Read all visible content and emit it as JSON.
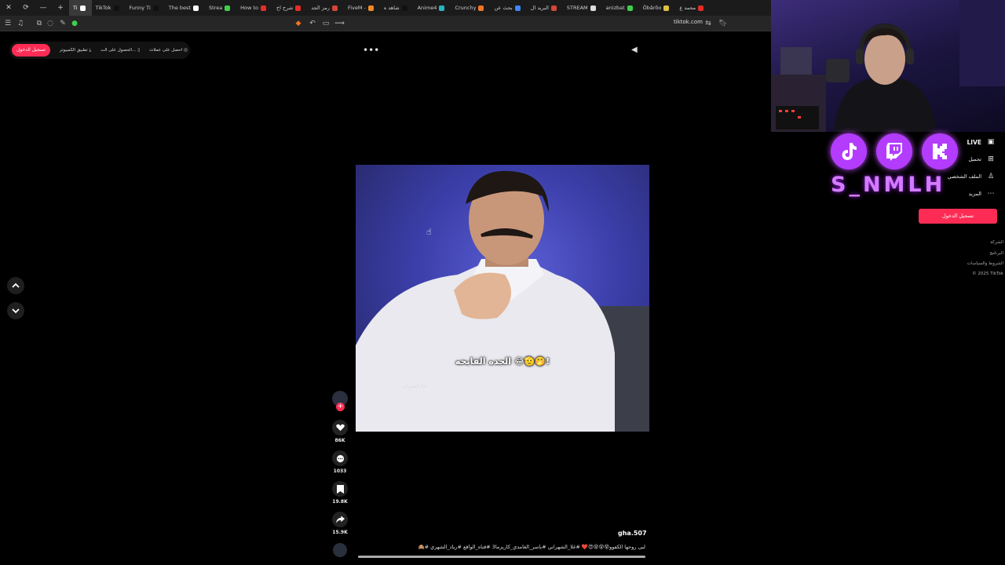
{
  "browser": {
    "tabs": [
      {
        "label": "Ti",
        "color": "#ffffff",
        "active": true
      },
      {
        "label": "TikTok",
        "color": "#111111"
      },
      {
        "label": "Funny Ti",
        "color": "#111111"
      },
      {
        "label": "The best",
        "color": "#ffffff"
      },
      {
        "label": "Strea",
        "color": "#3ecf4f"
      },
      {
        "label": "How to",
        "color": "#e52d27"
      },
      {
        "label": "شرح اخ",
        "color": "#e52d27"
      },
      {
        "label": "رمز الجد",
        "color": "#d44638"
      },
      {
        "label": "FiveM -",
        "color": "#f08a24"
      },
      {
        "label": "شاهد ه",
        "color": "#111111"
      },
      {
        "label": "Anime4",
        "color": "#2bb3c0"
      },
      {
        "label": "Crunchy",
        "color": "#f47521"
      },
      {
        "label": "بحث عن",
        "color": "#4285f4"
      },
      {
        "label": "البريد ال",
        "color": "#d44638"
      },
      {
        "label": "STREAM",
        "color": "#dddddd"
      },
      {
        "label": "anizbat",
        "color": "#3ecf4f"
      },
      {
        "label": "Öbârõo",
        "color": "#e0c040"
      },
      {
        "label": "محمد ع",
        "color": "#e52d27"
      }
    ],
    "url": "tiktok.com"
  },
  "top": {
    "login": "تسجيل الدخول",
    "desktop_app": "تطبيق الكمبيوتر",
    "get_app": "الحصول على الت...",
    "get_coins": "احصل على عملات"
  },
  "video": {
    "caption": "الجده القابحه 😂🫡🤭!",
    "watermark": "غلا الشهراني",
    "likes": "86K",
    "comments": "1033",
    "saves": "19.8K",
    "shares": "15.9K",
    "author": "gha.507",
    "description": "لبى روحها الكفوو😵😵😵😍❤️ #غلا_الشهراني #ياسر_الغامدي_كاريزما3 #قناه_الواقع #رياد_الشهري #🙈"
  },
  "overlay": {
    "brand": "S_NMLH",
    "socials": [
      {
        "name": "TikTok",
        "color": "#b33cff"
      },
      {
        "name": "Twitch",
        "color": "#b33cff"
      },
      {
        "name": "Kick",
        "color": "#b33cff"
      }
    ]
  },
  "sidebar": {
    "live": "LIVE",
    "upload": "تحميل",
    "profile": "الملف الشخصي",
    "more": "المزيد",
    "login": "تسجيل الدخول",
    "footer": [
      "الشركة",
      "البرنامج",
      "الشروط والسياسات",
      "© 2025 TikTok"
    ]
  },
  "colors": {
    "accent": "#fe2c55",
    "neon": "#b33cff"
  }
}
